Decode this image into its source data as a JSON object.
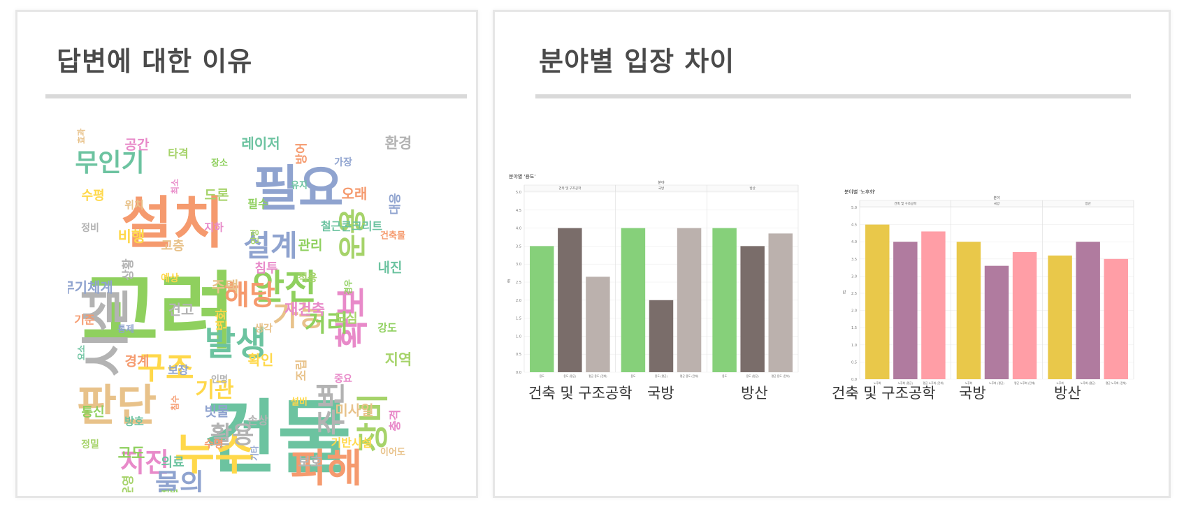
{
  "left_panel": {
    "title": "답변에 대한 이유",
    "wordcloud_words": [
      "고려",
      "건물",
      "설치",
      "필요",
      "시설",
      "누수",
      "판단",
      "확보",
      "장비",
      "안전",
      "발생",
      "피해",
      "설계",
      "주변",
      "구조",
      "가능",
      "지진",
      "운용",
      "거리",
      "무인기",
      "해당",
      "물의",
      "활용",
      "기관",
      "효과",
      "공간",
      "타격",
      "장소",
      "레이저",
      "방어",
      "가장",
      "환경",
      "수평",
      "위치",
      "최소",
      "드론",
      "필수",
      "유지",
      "오래",
      "대응",
      "정비",
      "비행",
      "고층",
      "지하",
      "안정",
      "관리",
      "철근콘크리트",
      "건축물",
      "무기체계",
      "상황",
      "예상",
      "주택",
      "침투",
      "적용",
      "경우",
      "내진",
      "기준",
      "통제",
      "견고",
      "변화",
      "생각",
      "재건축",
      "도심",
      "강도",
      "요소",
      "경계",
      "보장",
      "인명",
      "확인",
      "조립",
      "중요",
      "지역",
      "통신",
      "방호",
      "침수",
      "빗물",
      "손상",
      "설비",
      "미사일",
      "충격",
      "정밀",
      "고도",
      "의료",
      "수명",
      "기타",
      "보호",
      "기반시설",
      "이어도",
      "증가",
      "운영",
      "지반"
    ],
    "wordcloud_colors": [
      "#8fd05e",
      "#6cc3a0",
      "#f59a6e",
      "#8fa3cf",
      "#b3b3b3",
      "#ffd84a",
      "#e8c28a",
      "#e88ac9",
      "#a6d36a"
    ]
  },
  "right_panel": {
    "title": "분야별 입장 차이",
    "charts": [
      {
        "small_title": "분야별 '용도'",
        "field_header": "분야",
        "ylabel": "값",
        "ticks": [
          "0.0",
          "0.5",
          "1.0",
          "1.5",
          "2.0",
          "2.5",
          "3.0",
          "3.5",
          "4.0",
          "4.5",
          "5.0"
        ],
        "group_labels": [
          "건축 및 구조공학",
          "국방",
          "방산"
        ],
        "small_group_labels": [
          "건축 및 구조공학",
          "국방",
          "방산"
        ],
        "bar_labels": [
          "용도",
          "용도 (평균)",
          "평균 용도 (전체)"
        ]
      },
      {
        "small_title": "분야별 '노후화'",
        "field_header": "분야",
        "ylabel": "값",
        "ticks": [
          "0.0",
          "0.5",
          "1.0",
          "1.5",
          "2.0",
          "2.5",
          "3.0",
          "3.5",
          "4.0",
          "4.5",
          "5.0"
        ],
        "group_labels": [
          "건축 및 구조공학",
          "국방",
          "방산"
        ],
        "small_group_labels": [
          "건축 및 구조공학",
          "국방",
          "방산"
        ],
        "bar_labels": [
          "노후화",
          "노후화 (평균)",
          "평균 노후화 (전체)"
        ]
      }
    ]
  },
  "chart_data": [
    {
      "type": "bar",
      "title": "분야별 '용도'",
      "ylabel": "값",
      "ylim": [
        0,
        5
      ],
      "categories": [
        "건축 및 구조공학",
        "국방",
        "방산"
      ],
      "series": [
        {
          "name": "용도",
          "values": [
            3.5,
            4.0,
            4.0
          ],
          "color": "#86d07a"
        },
        {
          "name": "용도 (평균)",
          "values": [
            4.0,
            2.0,
            3.5
          ],
          "color": "#7a6d6a"
        },
        {
          "name": "평균 용도 (전체)",
          "values": [
            2.65,
            4.0,
            3.85
          ],
          "color": "#bbb1ad"
        }
      ]
    },
    {
      "type": "bar",
      "title": "분야별 '노후화'",
      "ylabel": "값",
      "ylim": [
        0,
        5
      ],
      "categories": [
        "건축 및 구조공학",
        "국방",
        "방산"
      ],
      "series": [
        {
          "name": "노후화",
          "values": [
            4.5,
            4.0,
            3.6
          ],
          "color": "#e9c84a"
        },
        {
          "name": "노후화 (평균)",
          "values": [
            4.0,
            3.3,
            4.0
          ],
          "color": "#b07b9f"
        },
        {
          "name": "평균 노후화 (전체)",
          "values": [
            4.3,
            3.7,
            3.5
          ],
          "color": "#ff9ea6"
        }
      ]
    }
  ]
}
